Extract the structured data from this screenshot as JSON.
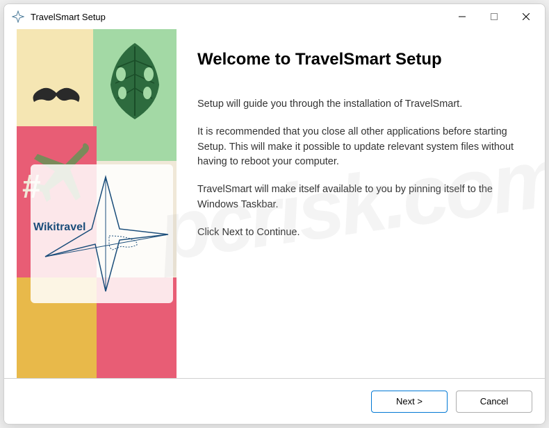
{
  "window": {
    "title": "TravelSmart Setup"
  },
  "content": {
    "heading": "Welcome to TravelSmart Setup",
    "paragraph1": "Setup will guide you through the installation of TravelSmart.",
    "paragraph2": "It is recommended that you close all other applications before starting Setup.  This will make it possible to update relevant system files without having to reboot your computer.",
    "paragraph3": "TravelSmart will make itself available to you by pinning itself to the Windows Taskbar.",
    "paragraph4": "Click Next to Continue."
  },
  "sidebar": {
    "logo_text": "Wikitravel",
    "hashtag": "#"
  },
  "footer": {
    "next_label": "Next >",
    "cancel_label": "Cancel"
  },
  "watermark": "pcrisk.com"
}
